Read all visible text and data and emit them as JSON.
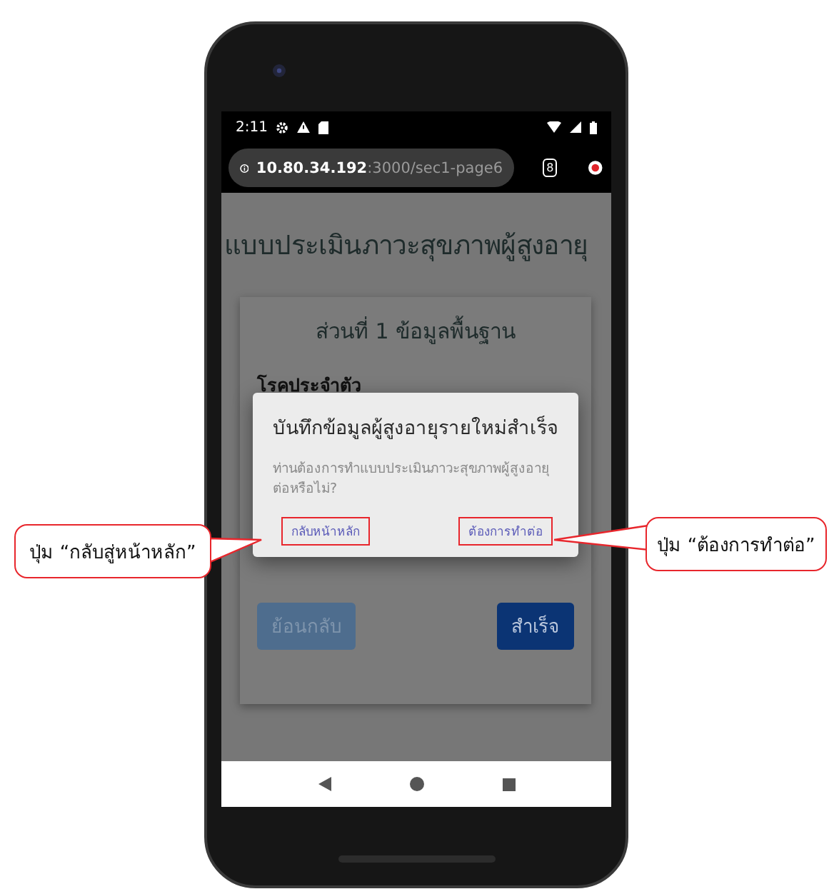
{
  "status_bar": {
    "time": "2:11"
  },
  "address_bar": {
    "url_host": "10.80.34.192",
    "url_path": ":3000/sec1-page6",
    "tab_count": "8"
  },
  "page": {
    "title": "แบบประเมินภาวะสุขภาพผู้สูงอายุ",
    "card": {
      "heading": "ส่วนที่ 1 ข้อมูลพื้นฐาน",
      "section_label": "โรคประจำตัว",
      "buttons": [
        {
          "label": "ย้อนกลับ",
          "kind": "secondary"
        },
        {
          "label": "สำเร็จ",
          "kind": "primary"
        }
      ]
    }
  },
  "dialog": {
    "title": "บันทึกข้อมูลผู้สูงอายุรายใหม่สำเร็จ",
    "message": "ท่านต้องการทำแบบประเมินภาวะสุขภาพผู้สูงอายุต่อหรือไม่?",
    "actions": [
      {
        "label": "กลับหน้าหลัก",
        "highlighted": true
      },
      {
        "label": "ต้องการทำต่อ",
        "highlighted": true
      }
    ]
  },
  "callouts": [
    {
      "text": "ปุ่ม “กลับสู่หน้าหลัก”",
      "kind": "left"
    },
    {
      "text": "ปุ่ม “ต้องการทำต่อ”",
      "kind": "right"
    }
  ]
}
